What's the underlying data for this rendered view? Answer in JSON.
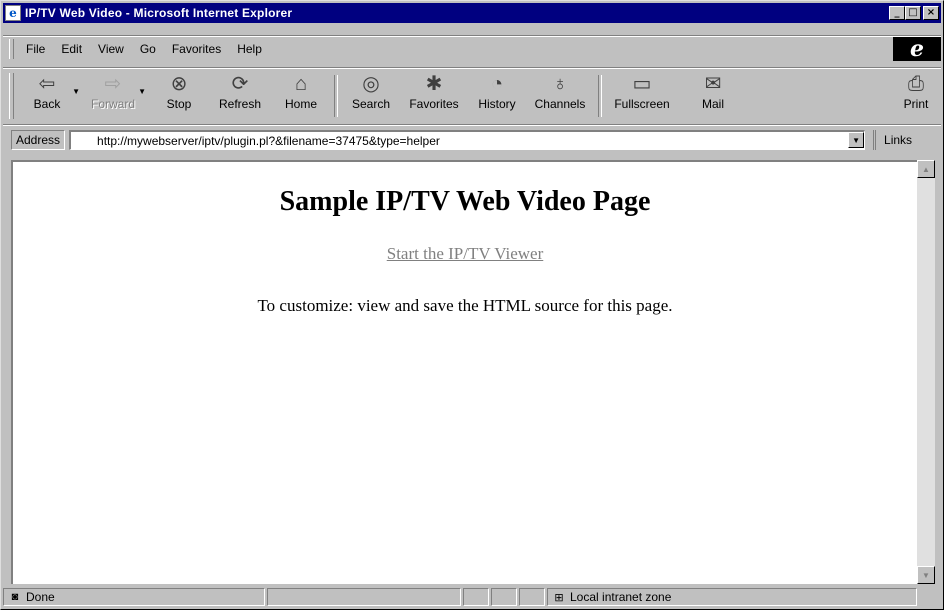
{
  "window": {
    "title": "IP/TV Web Video - Microsoft Internet Explorer",
    "controls": {
      "minimize": "_",
      "maximize": "□",
      "close": "×"
    }
  },
  "menu": {
    "items": [
      {
        "label": "File"
      },
      {
        "label": "Edit"
      },
      {
        "label": "View"
      },
      {
        "label": "Go"
      },
      {
        "label": "Favorites"
      },
      {
        "label": "Help"
      }
    ],
    "logo": "e"
  },
  "toolbar": {
    "buttons": [
      {
        "label": "Back",
        "icon": "back-arrow-icon",
        "enabled": true
      },
      {
        "label": "Forward",
        "icon": "forward-arrow-icon",
        "enabled": false
      },
      {
        "label": "Stop",
        "icon": "stop-icon",
        "enabled": true
      },
      {
        "label": "Refresh",
        "icon": "refresh-icon",
        "enabled": true
      },
      {
        "label": "Home",
        "icon": "home-icon",
        "enabled": true
      },
      {
        "label": "Search",
        "icon": "search-icon",
        "enabled": true
      },
      {
        "label": "Favorites",
        "icon": "favorites-icon",
        "enabled": true
      },
      {
        "label": "History",
        "icon": "history-icon",
        "enabled": true
      },
      {
        "label": "Channels",
        "icon": "channels-icon",
        "enabled": true
      },
      {
        "label": "Fullscreen",
        "icon": "fullscreen-icon",
        "enabled": true
      },
      {
        "label": "Mail",
        "icon": "mail-icon",
        "enabled": true
      },
      {
        "label": "Print",
        "icon": "print-icon",
        "enabled": true
      }
    ]
  },
  "address": {
    "label": "Address",
    "url": "http://mywebserver/iptv/plugin.pl?&filename=37475&type=helper",
    "links_label": "Links"
  },
  "page": {
    "title": "Sample IP/TV Web Video Page",
    "link_text": "Start the IP/TV Viewer",
    "instructions": "To customize: view and save the HTML source for this page."
  },
  "status": {
    "text": "Done",
    "zone": "Local intranet zone"
  },
  "colors": {
    "titlebar": "#000080",
    "chrome": "#c0c0c0",
    "link": "#808080"
  }
}
